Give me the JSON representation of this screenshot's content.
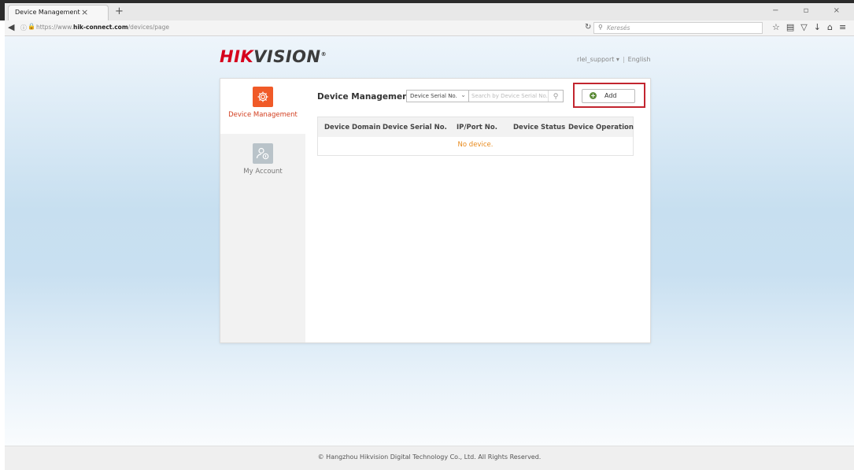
{
  "browser": {
    "tab_title": "Device Management",
    "tab_close": "×",
    "new_tab": "+",
    "window_controls": "− ▫ ×",
    "url_prefix": "https://www.",
    "url_domain": "hik-connect.com",
    "url_path": "/devices/page",
    "search_placeholder": "Keresés",
    "toolbar_icons": [
      "star-icon",
      "reading-list-icon",
      "pocket-icon",
      "download-icon",
      "home-icon",
      "menu-icon"
    ]
  },
  "header": {
    "logo_hik": "HIK",
    "logo_vision": "VISION",
    "logo_reg": "®",
    "username": "rlel_support",
    "username_caret": "▾",
    "separator": "|",
    "language": "English"
  },
  "sidebar": {
    "items": [
      {
        "label": "Device Management",
        "icon": "gear-icon",
        "active": true
      },
      {
        "label": "My Account",
        "icon": "account-icon",
        "active": false
      }
    ]
  },
  "main": {
    "title": "Device Management",
    "search_type": "Device Serial No.",
    "search_placeholder": "Search by Device Serial No.",
    "add_label": "Add",
    "table": {
      "columns": [
        "Device Domain",
        "Device Serial No.",
        "IP/Port No.",
        "Device Status",
        "Device Operation"
      ],
      "empty_text": "No device."
    }
  },
  "footer": {
    "text": "© Hangzhou Hikvision Digital Technology Co., Ltd. All Rights Reserved."
  },
  "colors": {
    "brand_red": "#d6001c",
    "active_orange": "#f05a28",
    "highlight_box": "#c2252f",
    "empty_text": "#e8891b"
  }
}
